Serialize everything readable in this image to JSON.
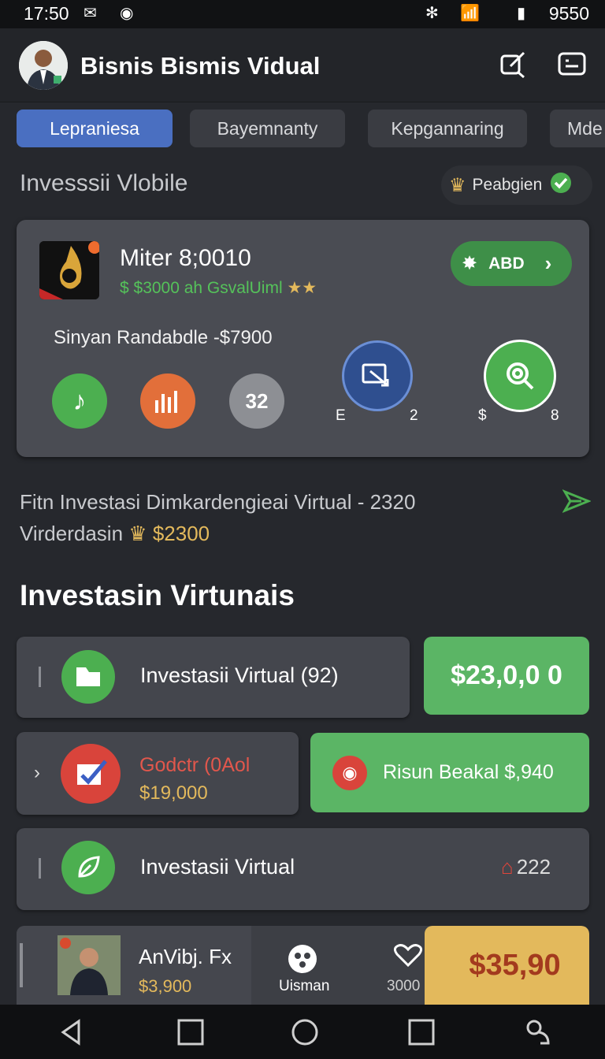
{
  "status": {
    "time": "17:50",
    "battery": "9550"
  },
  "header": {
    "title": "Bisnis Bismis Vidual"
  },
  "tabs": [
    "Lepraniesa",
    "Bayemnanty",
    "Kepgannaring",
    "Mde"
  ],
  "section": {
    "title": "Invesssii Vlobile",
    "badge": "Peabgien"
  },
  "card": {
    "title": "Miter 8;0010",
    "subtitle": "$ $3000 ah GsvalUiml",
    "action": "ABD",
    "line": "Sinyan Randabdle -$7900",
    "circle3": "32",
    "lbl_e": "E",
    "lbl_2": "2",
    "lbl_dollar": "$",
    "lbl_8": "8"
  },
  "promo": {
    "line1": "Fitn Investasi Dimkardengieai Virtual - 2320",
    "line2_text": "Virderdasin",
    "line2_amount": "$2300"
  },
  "heading": "Investasin Virtunais",
  "list": {
    "row1_label": "Investasii Virtual (92)",
    "row1_amount": "$23,0,0 0",
    "row2_title": "Godctr (0Aol",
    "row2_amount": "$19,000",
    "row2_action": "Risun Beakal $,940",
    "row3_label": "Investasii Virtual",
    "row3_count": "222"
  },
  "bottom": {
    "name": "AnVibj. Fx",
    "amount": "$3,900",
    "user_label": "Uisman",
    "count": "3000",
    "total": "$35,90"
  },
  "colors": {
    "accent_blue": "#4a6fc1",
    "green": "#5bb565",
    "yellow": "#e3b95c"
  }
}
